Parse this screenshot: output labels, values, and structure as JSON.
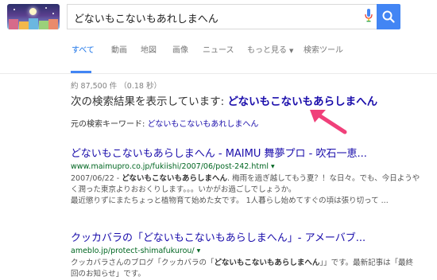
{
  "search": {
    "query": "どないもこないもあれしまへん"
  },
  "tabs": [
    {
      "label": "すべて"
    },
    {
      "label": "動画"
    },
    {
      "label": "地図"
    },
    {
      "label": "画像"
    },
    {
      "label": "ニュース"
    },
    {
      "label": "もっと見る"
    },
    {
      "label": "検索ツール"
    }
  ],
  "stats": "約 87,500 件 （0.18 秒）",
  "spell": {
    "showing_prefix": "次の検索結果を表示しています: ",
    "showing_query": "どないもこないもあらしまへん",
    "original_prefix": "元の検索キーワード: ",
    "original_query": "どないもこないもあれしまへん"
  },
  "results": [
    {
      "title": "どないもこないもあらしまへん - MAIMU 舞夢プロ - 吹石一恵...",
      "url": "www.maimupro.co.jp/fukiishi/2007/06/post-242.html",
      "snippet_lines": [
        "2007/06/22 - どないもこないもあらしまへん. 梅雨を過ぎ越してもう夏？！な日々。でも、今日ようやく潤った東京よりおおくりします。。。いかがお過ごしでしょうか。",
        "最近懲りずにまたちょっと植物育て始めた女です。 1人暮らし始めてすぐの頃は張り切って ..."
      ],
      "snippet_bold": "どないもこないもあらしまへん"
    },
    {
      "title": "クッカバラの「どないもこないもあらしまへん」- アメーバブ...",
      "url": "ameblo.jp/protect-shimafukurou/",
      "snippet_lines": [
        "クッカバラさんのブログ「クッカバラの「どないもこないもあらしまへん」」です。最新記事は「最終回のお知らせ」です。"
      ],
      "snippet_bold": "どないもこないもあらしまへん"
    }
  ],
  "colors": {
    "accent": "#4285f4",
    "link": "#1a0dab",
    "url": "#006621",
    "arrow": "#f0407a"
  }
}
